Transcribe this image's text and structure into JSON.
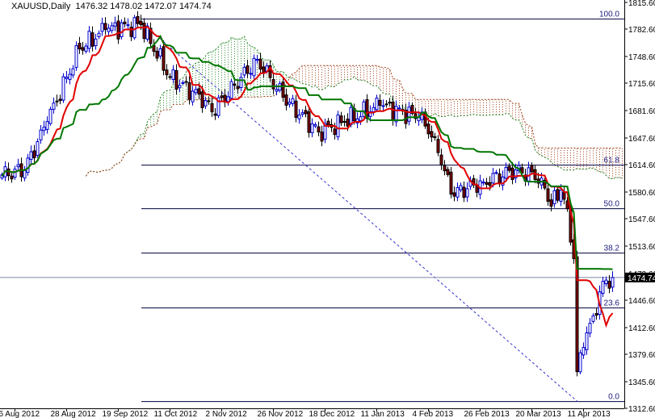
{
  "header": {
    "symbol": "XAUUSD,Daily",
    "ohlc": "1476.32 1478.02 1472.07 1474.74"
  },
  "chart_data": {
    "type": "candlestick",
    "title": "XAUUSD,Daily",
    "indicators": [
      "Ichimoku (Tenkan red, Kijun green, Kumo cloud)",
      "Fibonacci retracement"
    ],
    "ylim": [
      1312.6,
      1815.6
    ],
    "y_ticks": [
      "1815.60",
      "1782.60",
      "1748.60",
      "1715.60",
      "1681.60",
      "1647.60",
      "1614.60",
      "1580.60",
      "1547.60",
      "1513.60",
      "1479.60",
      "1446.60",
      "1412.60",
      "1379.60",
      "1345.60",
      "1312.60"
    ],
    "x_ticks": [
      {
        "bar": 4,
        "label": "6 Aug 2012"
      },
      {
        "bar": 20,
        "label": "28 Aug 2012"
      },
      {
        "bar": 36,
        "label": "19 Sep 2012"
      },
      {
        "bar": 52,
        "label": "11 Oct 2012"
      },
      {
        "bar": 68,
        "label": "2 Nov 2012"
      },
      {
        "bar": 84,
        "label": "26 Nov 2012"
      },
      {
        "bar": 100,
        "label": "18 Dec 2012"
      },
      {
        "bar": 116,
        "label": "11 Jan 2013"
      },
      {
        "bar": 132,
        "label": "4 Feb 2013"
      },
      {
        "bar": 148,
        "label": "26 Feb 2013"
      },
      {
        "bar": 164,
        "label": "20 Mar 2013"
      },
      {
        "bar": 180,
        "label": "11 Apr 2013"
      }
    ],
    "bar_count": 190,
    "close_keypoints": [
      [
        0,
        1602
      ],
      [
        7,
        1608
      ],
      [
        14,
        1668
      ],
      [
        24,
        1758
      ],
      [
        32,
        1782
      ],
      [
        43,
        1788
      ],
      [
        52,
        1723
      ],
      [
        63,
        1694
      ],
      [
        65,
        1680
      ],
      [
        79,
        1745
      ],
      [
        87,
        1698
      ],
      [
        98,
        1655
      ],
      [
        106,
        1668
      ],
      [
        117,
        1688
      ],
      [
        129,
        1673
      ],
      [
        134,
        1648
      ],
      [
        139,
        1578
      ],
      [
        149,
        1593
      ],
      [
        159,
        1608
      ],
      [
        167,
        1598
      ],
      [
        170,
        1563
      ],
      [
        173,
        1583
      ],
      [
        175,
        1560
      ],
      [
        177,
        1498
      ],
      [
        178,
        1358
      ],
      [
        180,
        1388
      ],
      [
        182,
        1418
      ],
      [
        184,
        1428
      ],
      [
        186,
        1470
      ],
      [
        189,
        1474.74
      ]
    ],
    "last_price": "1474.74",
    "fibonacci": [
      {
        "level": "100.0",
        "price": 1795
      },
      {
        "level": "61.8",
        "price": 1614
      },
      {
        "level": "50.0",
        "price": 1560
      },
      {
        "level": "38.2",
        "price": 1505
      },
      {
        "level": "23.6",
        "price": 1437
      },
      {
        "level": "0.0",
        "price": 1321
      }
    ],
    "colors": {
      "bull": "#0000cc",
      "bear": "#800000",
      "tenkan": "#e00000",
      "kijun": "#007700",
      "cloud_up": "#2a8a2a",
      "cloud_down": "#a0401a",
      "fib": "#000040",
      "price_line": "#7a8aa8"
    }
  }
}
